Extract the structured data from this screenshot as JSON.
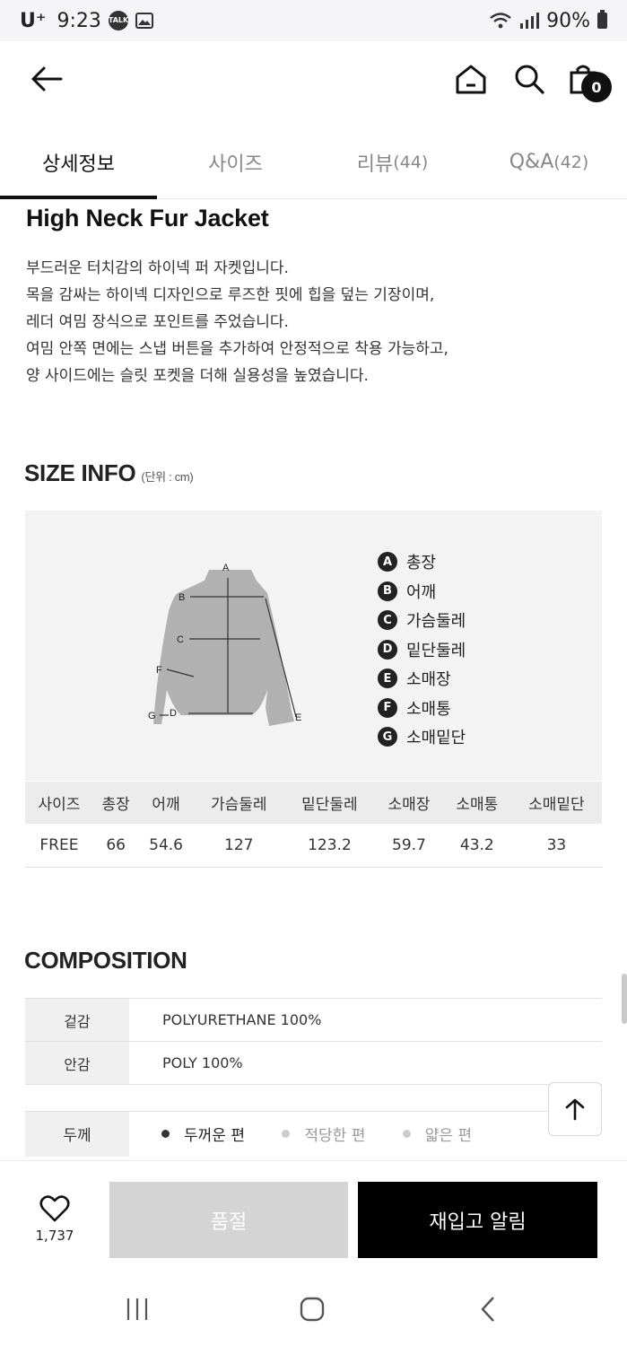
{
  "status_bar": {
    "carrier": "U⁺",
    "time": "9:23",
    "talk_label": "TALK",
    "battery": "90%"
  },
  "header": {
    "cart_count": "0"
  },
  "tabs": [
    {
      "label": "상세정보",
      "count": ""
    },
    {
      "label": "사이즈",
      "count": ""
    },
    {
      "label": "리뷰",
      "count": "(44)"
    },
    {
      "label": "Q&A",
      "count": "(42)"
    }
  ],
  "product": {
    "title": "High Neck Fur Jacket",
    "description": [
      "부드러운 터치감의 하이넥 퍼 자켓입니다.",
      "목을 감싸는 하이넥 디자인으로 루즈한 핏에 힙을 덮는 기장이며,",
      "레더 여밈 장식으로 포인트를 주었습니다.",
      "여밈 안쪽 면에는 스냅 버튼을 추가하여 안정적으로 착용 가능하고,",
      "양 사이드에는 슬릿 포켓을 더해 실용성을 높였습니다."
    ]
  },
  "size_info": {
    "title": "SIZE INFO",
    "unit": "(단위 : cm)",
    "diagram_letters": [
      "A",
      "B",
      "C",
      "D",
      "E",
      "F",
      "G"
    ],
    "legend": [
      {
        "letter": "A",
        "label": "총장"
      },
      {
        "letter": "B",
        "label": "어깨"
      },
      {
        "letter": "C",
        "label": "가슴둘레"
      },
      {
        "letter": "D",
        "label": "밑단둘레"
      },
      {
        "letter": "E",
        "label": "소매장"
      },
      {
        "letter": "F",
        "label": "소매통"
      },
      {
        "letter": "G",
        "label": "소매밑단"
      }
    ],
    "headers": [
      "사이즈",
      "총장",
      "어깨",
      "가슴둘레",
      "밑단둘레",
      "소매장",
      "소매통",
      "소매밑단"
    ],
    "rows": [
      [
        "FREE",
        "66",
        "54.6",
        "127",
        "123.2",
        "59.7",
        "43.2",
        "33"
      ]
    ]
  },
  "composition": {
    "title": "COMPOSITION",
    "rows": [
      {
        "label": "겉감",
        "value": "POLYURETHANE 100%"
      },
      {
        "label": "안감",
        "value": "POLY 100%"
      }
    ]
  },
  "thickness": {
    "label": "두께",
    "options": [
      "두꺼운 편",
      "적당한 편",
      "얇은 편"
    ],
    "selected": "두꺼운 편"
  },
  "bottom_bar": {
    "like_count": "1,737",
    "soldout_label": "품절",
    "restock_label": "재입고 알림"
  },
  "colors": {
    "accent": "#111111",
    "soldout_bg": "#d4d4d4",
    "restock_bg": "#000000",
    "card_bg": "#f3f3f3"
  }
}
